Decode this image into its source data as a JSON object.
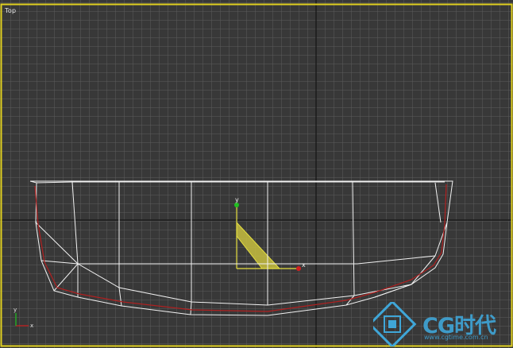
{
  "viewport": {
    "label": "Top",
    "border_color": "#e0d020",
    "background_color": "#383838",
    "grid_color": "#5a5a5a",
    "grid_major_color": "#1e1e1e"
  },
  "gizmo": {
    "x_label": "x",
    "y_label": "y",
    "x_color": "#d02020",
    "y_color": "#20c020"
  },
  "view_axis": {
    "x_label": "x",
    "y_label": "y"
  },
  "watermark": {
    "logo_text": "CG时代",
    "url_text": "www.cgtime.com.cn",
    "color": "#3fa6d8"
  },
  "mesh": {
    "wire_color": "#f2f2f2",
    "edge_color": "#b02020",
    "selection_fill": "#c8c040"
  }
}
